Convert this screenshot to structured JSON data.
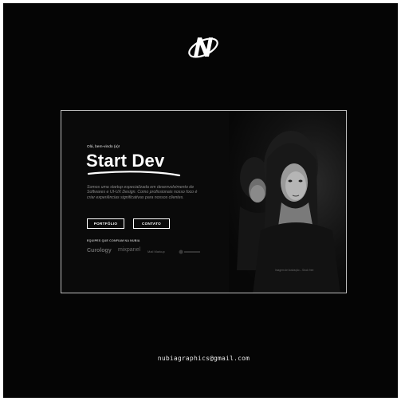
{
  "brand": {
    "logo_icon": "n-orbit-logo-icon"
  },
  "hero": {
    "greeting": "Olá, bem-vindo (a)!",
    "headline": "Start Dev",
    "description": "Somos uma startup especializada em desenvolvimento de Softwares e UI-UX Design. Como profissionais nosso foco é criar experiências significativas para nossos clientes.",
    "buttons": {
      "portfolio": "PORTFÓLIO",
      "contato": "CONTATO"
    }
  },
  "partners": {
    "label": "EQUIPES QUE CONFIAM NA NUBIA",
    "logos": [
      "Curology",
      "mixpanel",
      "Mail Markup",
      ""
    ]
  },
  "photo": {
    "caption": "Imagem de ilustração – Stock free"
  },
  "footer": {
    "email": "nubiagraphics@gmail.com"
  },
  "colors": {
    "background": "#050505",
    "text": "#ffffff",
    "muted": "#8a8a8a",
    "border": "#bdbdbd"
  }
}
